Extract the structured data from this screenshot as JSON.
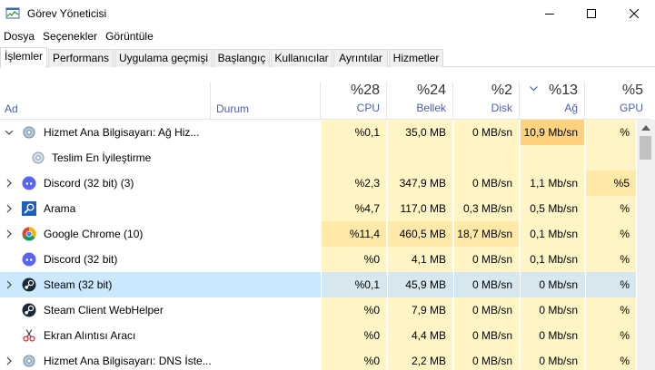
{
  "window": {
    "title": "Görev Yöneticisi",
    "icon": "task-manager-icon"
  },
  "menu": [
    "Dosya",
    "Seçenekler",
    "Görüntüle"
  ],
  "tabs": [
    "İşlemler",
    "Performans",
    "Uygulama geçmişi",
    "Başlangıç",
    "Kullanıcılar",
    "Ayrıntılar",
    "Hizmetler"
  ],
  "active_tab": "İşlemler",
  "columns": {
    "name": "Ad",
    "status": "Durum",
    "cpu": {
      "pct": "%28",
      "label": "CPU"
    },
    "mem": {
      "pct": "%24",
      "label": "Bellek"
    },
    "disk": {
      "pct": "%2",
      "label": "Disk"
    },
    "net": {
      "pct": "%13",
      "label": "Ağ"
    },
    "gpu": {
      "pct": "%5",
      "label": "GPU"
    }
  },
  "rows": [
    {
      "name": "Hizmet Ana Bilgisayarı: Ağ Hiz...",
      "icon": "gear-icon",
      "expander": "expanded",
      "cpu": "%0,1",
      "mem": "35,0 MB",
      "disk": "0 MB/sn",
      "net": "10,9 Mb/sn",
      "gpu": "%"
    },
    {
      "name": "Teslim En İyileştirme",
      "icon": "gear-icon",
      "expander": "none",
      "child": true,
      "cpu": "",
      "mem": "",
      "disk": "",
      "net": "",
      "gpu": ""
    },
    {
      "name": "Discord (32 bit) (3)",
      "icon": "discord-icon",
      "expander": "collapsed",
      "cpu": "%2,3",
      "mem": "347,9 MB",
      "disk": "0 MB/sn",
      "net": "1,1 Mb/sn",
      "gpu": "%5"
    },
    {
      "name": "Arama",
      "icon": "search-icon",
      "expander": "collapsed",
      "cpu": "%4,7",
      "mem": "117,0 MB",
      "disk": "0,3 MB/sn",
      "net": "0,5 Mb/sn",
      "gpu": "%"
    },
    {
      "name": "Google Chrome (10)",
      "icon": "chrome-icon",
      "expander": "collapsed",
      "cpu": "%11,4",
      "mem": "460,5 MB",
      "disk": "18,7 MB/sn",
      "net": "0,1 Mb/sn",
      "gpu": "%"
    },
    {
      "name": "Discord (32 bit)",
      "icon": "discord-icon",
      "expander": "none",
      "cpu": "%0",
      "mem": "4,1 MB",
      "disk": "0 MB/sn",
      "net": "0,1 Mb/sn",
      "gpu": "%"
    },
    {
      "name": "Steam (32 bit)",
      "icon": "steam-icon",
      "expander": "collapsed",
      "selected": true,
      "cpu": "%0,1",
      "mem": "45,9 MB",
      "disk": "0 MB/sn",
      "net": "0 Mb/sn",
      "gpu": "%"
    },
    {
      "name": "Steam Client WebHelper",
      "icon": "steam-icon",
      "expander": "none",
      "cpu": "%0",
      "mem": "7,9 MB",
      "disk": "0 MB/sn",
      "net": "0 Mb/sn",
      "gpu": "%"
    },
    {
      "name": "Ekran Alıntısı Aracı",
      "icon": "snipping-tool-icon",
      "expander": "none",
      "cpu": "%0",
      "mem": "4,4 MB",
      "disk": "0 MB/sn",
      "net": "0 Mb/sn",
      "gpu": "%"
    },
    {
      "name": "Hizmet Ana Bilgisayarı: DNS İste...",
      "icon": "gear-icon",
      "expander": "collapsed",
      "cpu": "%0",
      "mem": "2,2 MB",
      "disk": "0 MB/sn",
      "net": "0 Mb/sn",
      "gpu": "%"
    }
  ],
  "colors": {
    "heat_low": "#fff4c4",
    "heat_mid": "#ffe9a8",
    "heat_high": "#ffd280",
    "header_label": "#4c60a8",
    "selection": "#cce8ff"
  }
}
